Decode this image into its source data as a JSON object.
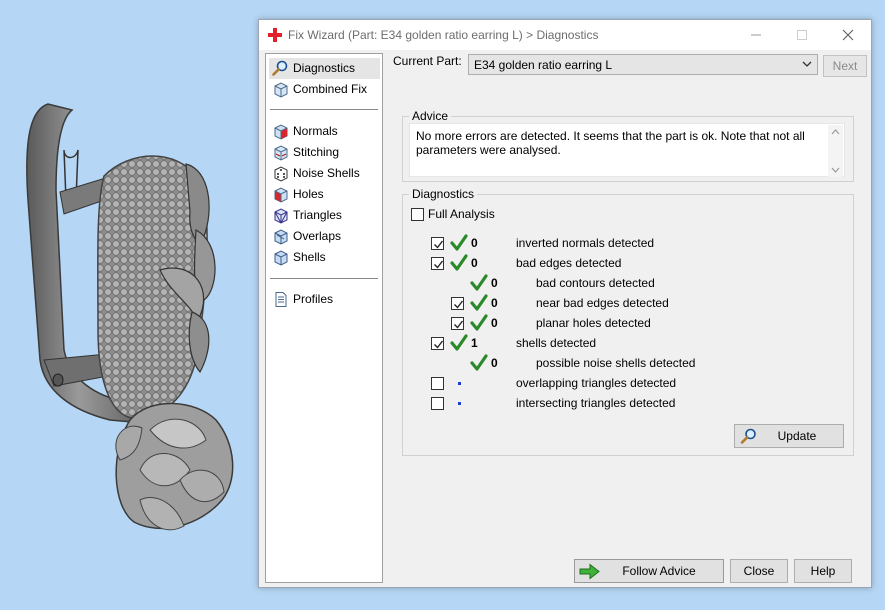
{
  "window": {
    "title": "Fix Wizard (Part: E34 golden ratio earring L) > Diagnostics",
    "icon": "red-cross-icon"
  },
  "nav": {
    "items": [
      {
        "label": "Diagnostics",
        "icon": "magnifier-icon",
        "selected": true
      },
      {
        "label": "Combined Fix",
        "icon": "cube-icon"
      },
      {
        "label": "Normals",
        "icon": "normals-cube-icon"
      },
      {
        "label": "Stitching",
        "icon": "stitching-cube-icon"
      },
      {
        "label": "Noise Shells",
        "icon": "dice-icon"
      },
      {
        "label": "Holes",
        "icon": "holes-cube-icon"
      },
      {
        "label": "Triangles",
        "icon": "triangles-cube-icon"
      },
      {
        "label": "Overlaps",
        "icon": "overlaps-cube-icon"
      },
      {
        "label": "Shells",
        "icon": "shells-cube-icon"
      },
      {
        "label": "Profiles",
        "icon": "document-icon"
      }
    ]
  },
  "part": {
    "label": "Current Part:",
    "value": "E34 golden ratio earring L",
    "next_label": "Next"
  },
  "advice": {
    "title": "Advice",
    "text": "No more errors are detected. It seems that the part is ok. Note that not all parameters were analysed."
  },
  "diagnostics": {
    "title": "Diagnostics",
    "full_analysis_label": "Full Analysis",
    "rows": [
      {
        "checked": true,
        "status": "ok",
        "count": "0",
        "label": "inverted normals detected"
      },
      {
        "checked": true,
        "status": "ok",
        "count": "0",
        "label": "bad edges detected"
      },
      {
        "checked": null,
        "status": "ok",
        "count": "0",
        "label": "bad contours detected"
      },
      {
        "checked": true,
        "status": "ok",
        "count": "0",
        "label": "near bad edges detected"
      },
      {
        "checked": true,
        "status": "ok",
        "count": "0",
        "label": "planar holes detected"
      },
      {
        "checked": true,
        "status": "ok",
        "count": "1",
        "label": "shells detected"
      },
      {
        "checked": null,
        "status": "ok",
        "count": "0",
        "label": "possible noise shells detected"
      },
      {
        "checked": false,
        "status": "not-run",
        "count": "",
        "label": "overlapping triangles detected"
      },
      {
        "checked": false,
        "status": "not-run",
        "count": "",
        "label": "intersecting triangles detected"
      }
    ],
    "update_label": "Update"
  },
  "footer": {
    "follow_advice_label": "Follow Advice",
    "close_label": "Close",
    "help_label": "Help"
  },
  "colors": {
    "desktop": "#b5d6f4",
    "tick_green": "#2a8a2a",
    "not_run_dot": "#1a3fd8",
    "title_cross": "#e0202a"
  }
}
